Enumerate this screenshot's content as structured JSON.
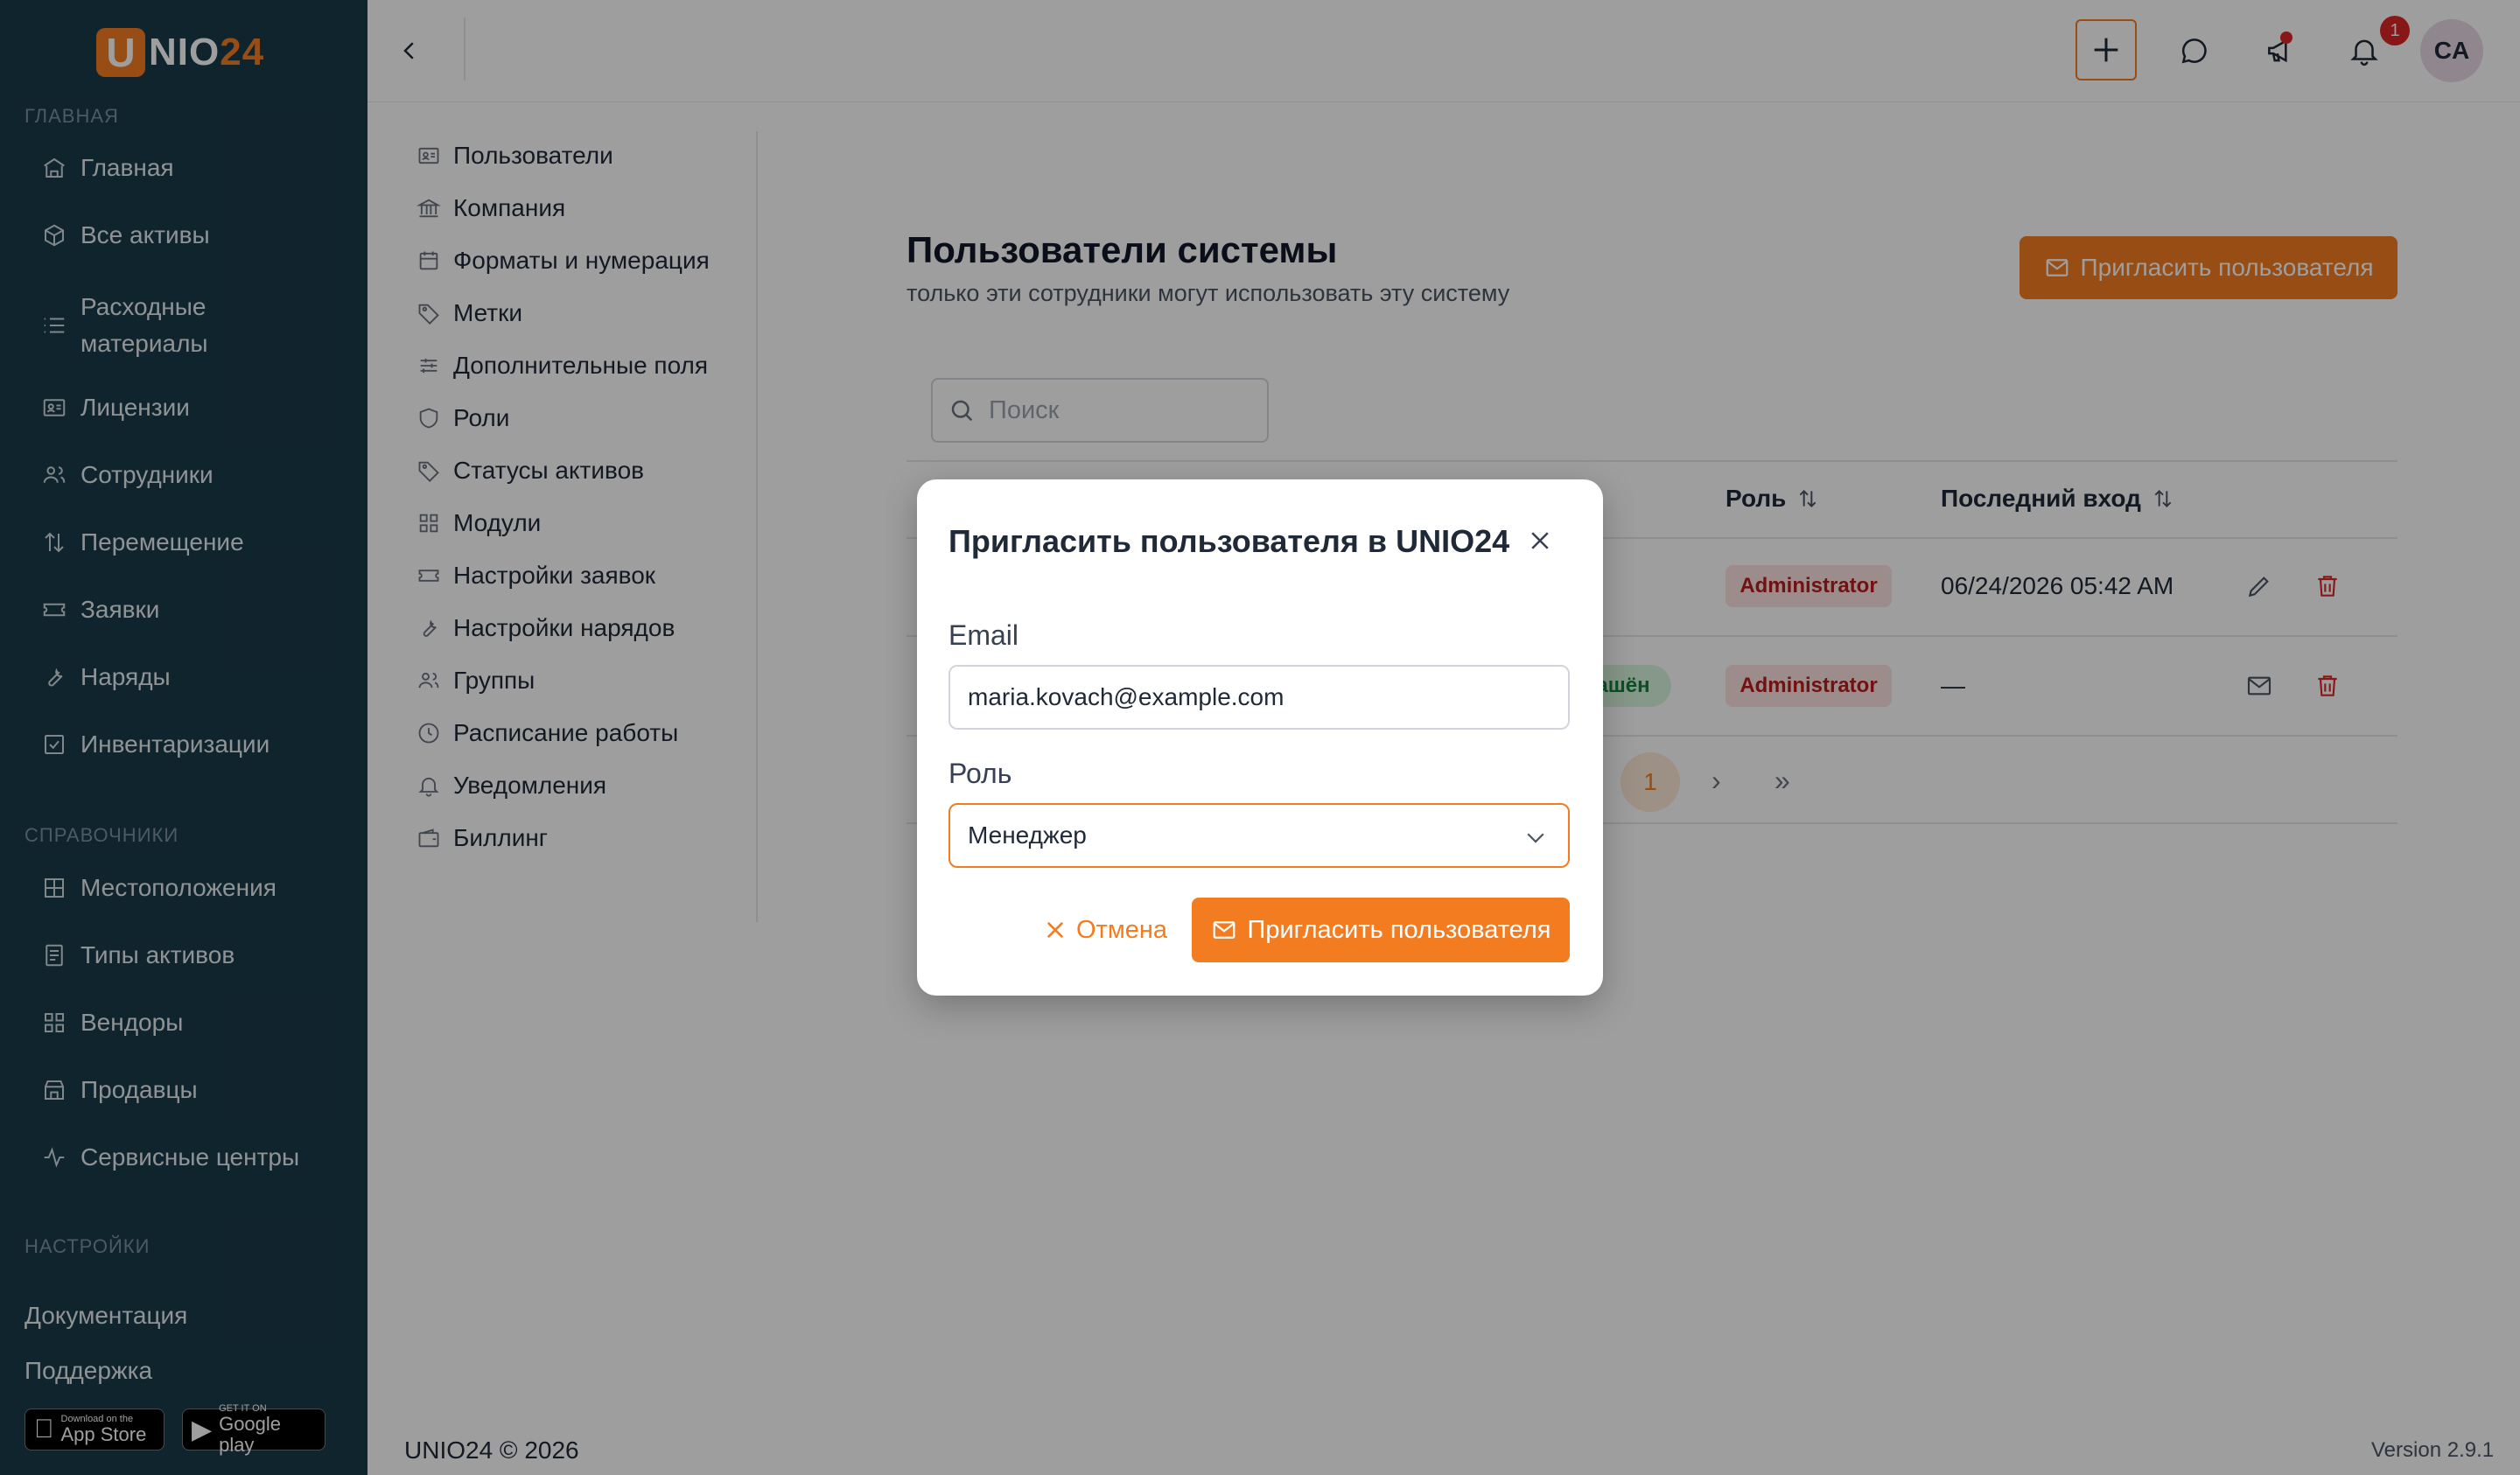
{
  "brand": {
    "logo_letter": "U",
    "logo_text_a": "NIO",
    "logo_text_b": "24"
  },
  "sidebar": {
    "section_main": "ГЛАВНАЯ",
    "items_main": [
      {
        "label": "Главная",
        "icon": "home-icon"
      },
      {
        "label": "Все активы",
        "icon": "box-icon"
      },
      {
        "label": "Расходные материалы",
        "icon": "list-icon"
      },
      {
        "label": "Лицензии",
        "icon": "id-card-icon"
      },
      {
        "label": "Сотрудники",
        "icon": "users-icon"
      },
      {
        "label": "Перемещение",
        "icon": "arrows-updown-icon"
      },
      {
        "label": "Заявки",
        "icon": "ticket-icon"
      },
      {
        "label": "Наряды",
        "icon": "wrench-icon"
      },
      {
        "label": "Инвентаризации",
        "icon": "checkbox-icon"
      }
    ],
    "section_refs": "СПРАВОЧНИКИ",
    "items_refs": [
      {
        "label": "Местоположения",
        "icon": "grid-icon"
      },
      {
        "label": "Типы активов",
        "icon": "document-icon"
      },
      {
        "label": "Вендоры",
        "icon": "apps-icon"
      },
      {
        "label": "Продавцы",
        "icon": "store-icon"
      },
      {
        "label": "Сервисные центры",
        "icon": "activity-icon"
      }
    ],
    "section_settings": "НАСТРОЙКИ",
    "link_docs": "Документация",
    "link_support": "Поддержка",
    "appstore_small": "Download on the",
    "appstore_big": "App Store",
    "googleplay_small": "GET IT ON",
    "googleplay_big": "Google play"
  },
  "topbar": {
    "notification_count": "1",
    "avatar_initials": "CA"
  },
  "settings_menu": [
    {
      "label": "Пользователи",
      "icon": "user-card-icon"
    },
    {
      "label": "Компания",
      "icon": "bank-icon"
    },
    {
      "label": "Форматы и нумерация",
      "icon": "calendar-icon"
    },
    {
      "label": "Метки",
      "icon": "tag-icon"
    },
    {
      "label": "Дополнительные поля",
      "icon": "sliders-icon"
    },
    {
      "label": "Роли",
      "icon": "shield-icon"
    },
    {
      "label": "Статусы активов",
      "icon": "tags-icon"
    },
    {
      "label": "Модули",
      "icon": "modules-icon"
    },
    {
      "label": "Настройки заявок",
      "icon": "ticket-icon"
    },
    {
      "label": "Настройки нарядов",
      "icon": "wrench-icon"
    },
    {
      "label": "Группы",
      "icon": "group-icon"
    },
    {
      "label": "Расписание работы",
      "icon": "clock-icon"
    },
    {
      "label": "Уведомления",
      "icon": "bell-icon"
    },
    {
      "label": "Биллинг",
      "icon": "wallet-icon"
    }
  ],
  "main": {
    "title": "Пользователи системы",
    "subtitle": "только эти сотрудники могут использовать эту систему",
    "invite_button": "Пригласить пользователя",
    "search_placeholder": "Поиск",
    "columns": {
      "role": "Роль",
      "last_login": "Последний вход"
    },
    "rows": [
      {
        "role": "Administrator",
        "last_login": "06/24/2026 05:42 AM",
        "status": ""
      },
      {
        "role": "Administrator",
        "last_login": "—",
        "status": "ашён"
      }
    ],
    "current_page": "1"
  },
  "modal": {
    "title": "Пригласить пользователя в UNIO24",
    "email_label": "Email",
    "email_value": "maria.kovach@example.com",
    "role_label": "Роль",
    "role_value": "Менеджер",
    "cancel_label": "Отмена",
    "submit_label": "Пригласить пользователя"
  },
  "footer": {
    "copyright": "UNIO24 © 2026",
    "version": "Version 2.9.1"
  },
  "colors": {
    "accent": "#f47c20",
    "sidebar_bg": "#1b3a4b",
    "danger": "#dc2626"
  }
}
